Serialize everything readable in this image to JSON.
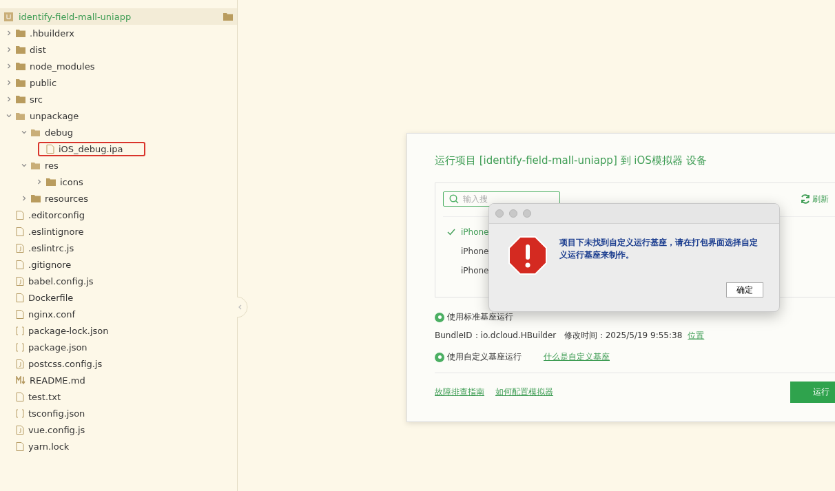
{
  "sidebar": {
    "project": {
      "name": "identify-field-mall-uniapp"
    },
    "tree": [
      {
        "name": ".hbuilderx",
        "kind": "folder",
        "expanded": false
      },
      {
        "name": "dist",
        "kind": "folder",
        "expanded": false
      },
      {
        "name": "node_modules",
        "kind": "folder",
        "expanded": false
      },
      {
        "name": "public",
        "kind": "folder",
        "expanded": false
      },
      {
        "name": "src",
        "kind": "folder",
        "expanded": false
      },
      {
        "name": "unpackage",
        "kind": "folder",
        "expanded": true,
        "children": [
          {
            "name": "debug",
            "kind": "folder",
            "expanded": true,
            "children": [
              {
                "name": "iOS_debug.ipa",
                "kind": "file",
                "highlighted": true
              }
            ]
          },
          {
            "name": "res",
            "kind": "folder",
            "expanded": true,
            "children": [
              {
                "name": "icons",
                "kind": "folder",
                "expanded": false
              }
            ]
          },
          {
            "name": "resources",
            "kind": "folder",
            "expanded": false
          }
        ]
      },
      {
        "name": ".editorconfig",
        "kind": "file",
        "highlighted": false
      },
      {
        "name": ".eslintignore",
        "kind": "file",
        "highlighted": false
      },
      {
        "name": ".eslintrc.js",
        "kind": "script",
        "highlighted": false
      },
      {
        "name": ".gitignore",
        "kind": "file",
        "highlighted": false
      },
      {
        "name": "babel.config.js",
        "kind": "script",
        "highlighted": false
      },
      {
        "name": "Dockerfile",
        "kind": "file",
        "highlighted": false
      },
      {
        "name": "nginx.conf",
        "kind": "file",
        "highlighted": false
      },
      {
        "name": "package-lock.json",
        "kind": "json",
        "highlighted": false
      },
      {
        "name": "package.json",
        "kind": "json",
        "highlighted": false
      },
      {
        "name": "postcss.config.js",
        "kind": "script",
        "highlighted": false
      },
      {
        "name": "README.md",
        "kind": "markdown",
        "highlighted": false
      },
      {
        "name": "test.txt",
        "kind": "file",
        "highlighted": false
      },
      {
        "name": "tsconfig.json",
        "kind": "json",
        "highlighted": false
      },
      {
        "name": "vue.config.js",
        "kind": "script",
        "highlighted": false
      },
      {
        "name": "yarn.lock",
        "kind": "file",
        "highlighted": false
      }
    ]
  },
  "run_dialog": {
    "title": "运行项目 [identify-field-mall-uniapp] 到 iOS模拟器 设备",
    "search": {
      "placeholder": "输入搜"
    },
    "refresh": "刷新",
    "devices": [
      {
        "name": "iPhone",
        "selected": true
      },
      {
        "name": "iPhone",
        "selected": false
      },
      {
        "name": "iPhone",
        "selected": false
      }
    ],
    "standard_base": {
      "label": "使用标准基座运行",
      "selected": true
    },
    "bundle_info": "BundleID：io.dcloud.HBuilder   修改时间：2025/5/19 9:55:38",
    "location_link": "位置",
    "custom_base": {
      "label": "使用自定义基座运行",
      "selected": true
    },
    "custom_base_link": "什么是自定义基座",
    "footer_links": [
      "故障排查指南",
      "如何配置模拟器"
    ],
    "run_button": "运行"
  },
  "alert": {
    "message": "项目下未找到自定义运行基座，请在打包界面选择自定义运行基座来制作。",
    "ok_button": "确定"
  }
}
